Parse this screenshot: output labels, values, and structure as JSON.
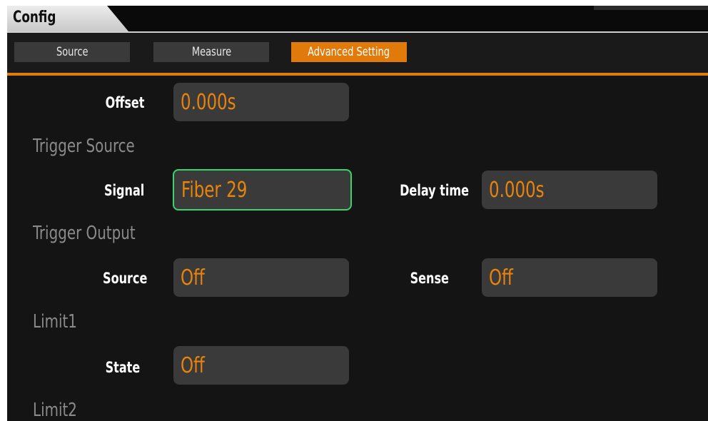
{
  "window": {
    "title": "Config"
  },
  "tabs": [
    {
      "label": "Source",
      "active": false
    },
    {
      "label": "Measure",
      "active": false
    },
    {
      "label": "Advanced Setting",
      "active": true
    }
  ],
  "content": {
    "offset": {
      "label": "Offset",
      "value": "0.000s"
    },
    "trigger_source": {
      "heading": "Trigger Source",
      "signal": {
        "label": "Signal",
        "value": "Fiber 29"
      },
      "delay": {
        "label": "Delay time",
        "value": "0.000s"
      }
    },
    "trigger_output": {
      "heading": "Trigger Output",
      "source": {
        "label": "Source",
        "value": "Off"
      },
      "sense": {
        "label": "Sense",
        "value": "Off"
      }
    },
    "limit1": {
      "heading": "Limit1",
      "state": {
        "label": "State",
        "value": "Off"
      }
    },
    "limit2": {
      "heading": "Limit2"
    }
  },
  "colors": {
    "accent": "#e07a0a",
    "value_text": "#e8840c",
    "focus_border": "#36d66b",
    "field_bg": "#3a3a3a",
    "section_text": "#8a8a8a"
  }
}
